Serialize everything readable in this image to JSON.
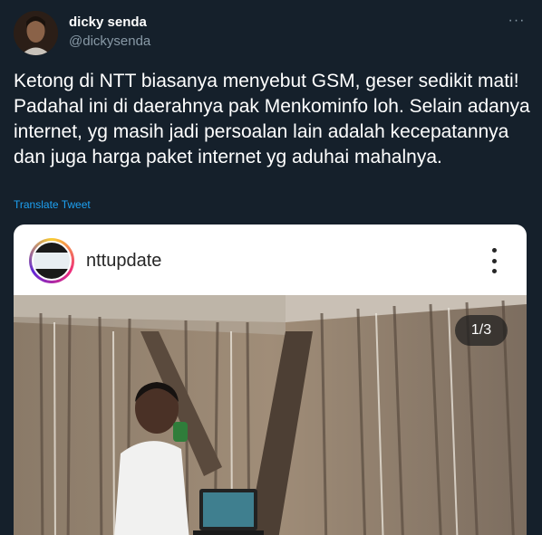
{
  "author": {
    "name": "dicky senda",
    "handle": "@dickysenda",
    "avatar_icon": "profile-photo"
  },
  "more_glyph": "···",
  "tweet": {
    "text": "Ketong di NTT biasanya menyebut GSM, geser sedikit mati! Padahal ini di daerahnya pak Menkominfo loh. Selain adanya internet, yg masih jadi persoalan lain adalah kecepatannya dan juga harga paket internet yg aduhai mahalnya.",
    "translate_label": "Translate Tweet"
  },
  "embed": {
    "username": "nttupdate",
    "photo_counter": "1/3",
    "photo_icon": "photo-student-laptop-wooden-hut"
  },
  "colors": {
    "background": "#15202b",
    "link": "#1da1f2",
    "secondary_text": "#8899a6",
    "card_background": "#ffffff"
  }
}
